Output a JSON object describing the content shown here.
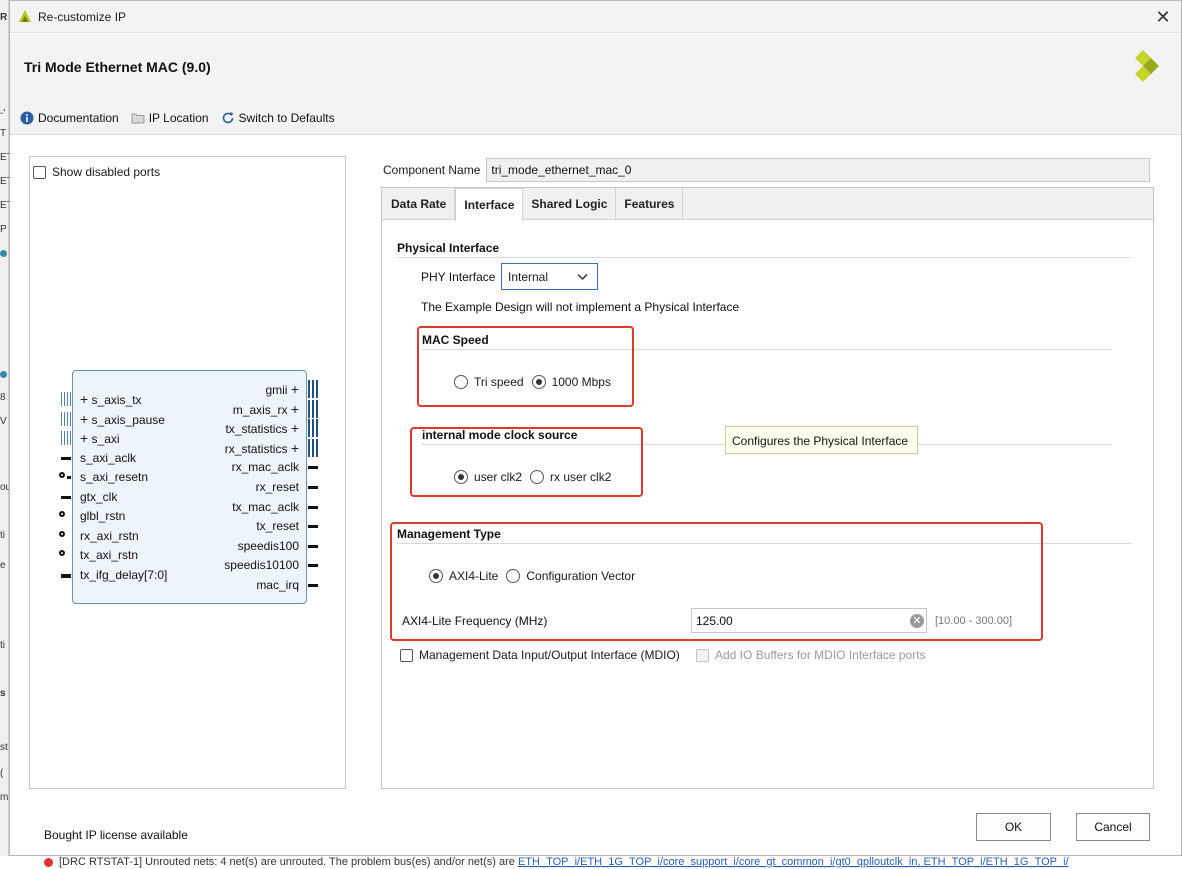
{
  "window": {
    "title": "Re-customize IP"
  },
  "header": {
    "ip_title": "Tri Mode Ethernet MAC (9.0)"
  },
  "toolbar": {
    "documentation": "Documentation",
    "ip_location": "IP Location",
    "switch_defaults": "Switch to Defaults"
  },
  "left_panel": {
    "show_disabled_ports": "Show disabled ports",
    "left_pins": [
      "s_axis_tx",
      "s_axis_pause",
      "s_axi",
      "s_axi_aclk",
      "s_axi_resetn",
      "gtx_clk",
      "glbl_rstn",
      "rx_axi_rstn",
      "tx_axi_rstn",
      "tx_ifg_delay[7:0]"
    ],
    "right_pins": [
      "gmii",
      "m_axis_rx",
      "tx_statistics",
      "rx_statistics",
      "rx_mac_aclk",
      "rx_reset",
      "tx_mac_aclk",
      "tx_reset",
      "speedis100",
      "speedis10100",
      "mac_irq"
    ]
  },
  "component": {
    "label": "Component Name",
    "value": "tri_mode_ethernet_mac_0"
  },
  "tabs": [
    "Data Rate",
    "Interface",
    "Shared Logic",
    "Features"
  ],
  "physical_interface": {
    "title": "Physical Interface",
    "phy_label": "PHY Interface",
    "phy_value": "Internal",
    "note": "The Example Design will not implement a Physical Interface"
  },
  "mac_speed": {
    "title": "MAC Speed",
    "options": [
      "Tri speed",
      "1000 Mbps"
    ],
    "selected": "1000 Mbps"
  },
  "clock_source": {
    "title": "internal mode clock source",
    "options": [
      "user clk2",
      "rx user clk2"
    ],
    "selected": "user clk2"
  },
  "tooltip": {
    "text": "Configures the Physical Interface"
  },
  "management": {
    "title": "Management Type",
    "options": [
      "AXI4-Lite",
      "Configuration Vector"
    ],
    "selected": "AXI4-Lite",
    "freq_label": "AXI4-Lite Frequency (MHz)",
    "freq_value": "125.00",
    "freq_range": "[10.00 - 300.00]"
  },
  "mdio": {
    "label": "Management Data Input/Output Interface (MDIO)",
    "buffers_label": "Add IO Buffers for MDIO Interface ports"
  },
  "footer": {
    "license": "Bought IP license available",
    "ok": "OK",
    "cancel": "Cancel"
  },
  "background": {
    "left_fragments": [
      "R",
      "-'",
      "T",
      "ET",
      "ET",
      "ET",
      "P",
      "8",
      "V",
      "ou",
      "ti",
      "e",
      "ti",
      "s",
      "st",
      "(",
      "m"
    ],
    "status_msg": "[DRC RTSTAT-1] Unrouted nets: 4 net(s) are unrouted. The problem bus(es) and/or net(s) are",
    "status_link": "ETH_TOP_i/ETH_1G_TOP_i/core_support_i/core_gt_common_i/gt0_qplloutclk_in, ETH_TOP_i/ETH_1G_TOP_i/"
  },
  "colors": {
    "highlight": "#e0392b",
    "accent_border": "#3e6fb8",
    "brand_yellow": "#b4c41b"
  }
}
